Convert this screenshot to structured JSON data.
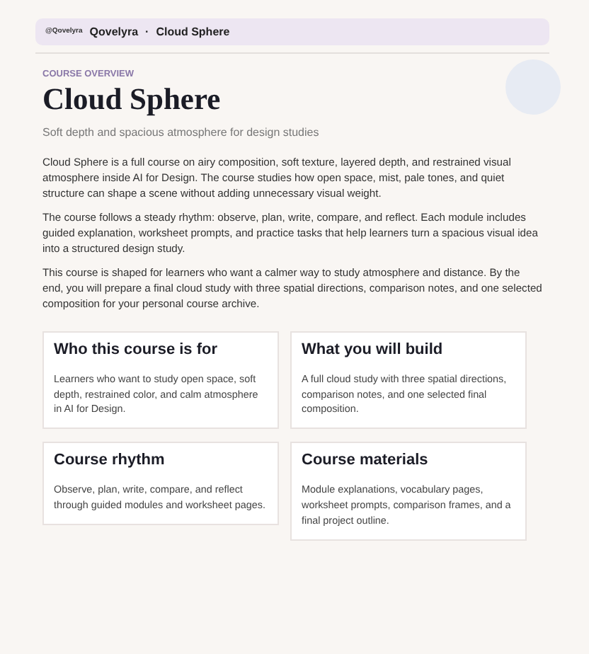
{
  "header": {
    "logo": "@Qovelyra",
    "brand": "Qovelyra",
    "separator": "·",
    "page": "Cloud Sphere"
  },
  "hero": {
    "eyebrow": "COURSE OVERVIEW",
    "title": "Cloud Sphere",
    "subtitle": "Soft depth and spacious atmosphere for design studies"
  },
  "paragraphs": [
    "Cloud Sphere is a full course on airy composition, soft texture, layered depth, and restrained visual atmosphere inside AI for Design. The course studies how open space, mist, pale tones, and quiet structure can shape a scene without adding unnecessary visual weight.",
    "The course follows a steady rhythm: observe, plan, write, compare, and reflect. Each module includes guided explanation, worksheet prompts, and practice tasks that help learners turn a spacious visual idea into a structured design study.",
    "This course is shaped for learners who want a calmer way to study atmosphere and distance. By the end, you will prepare a final cloud study with three spatial directions, comparison notes, and one selected composition for your personal course archive."
  ],
  "cards": [
    {
      "title": "Who this course is for",
      "text": "Learners who want to study open space, soft depth, restrained color, and calm atmosphere in AI for Design."
    },
    {
      "title": "What you will build",
      "text": "A full cloud study with three spatial directions, comparison notes, and one selected final composition."
    },
    {
      "title": "Course rhythm",
      "text": "Observe, plan, write, compare, and reflect through guided modules and worksheet pages."
    },
    {
      "title": "Course materials",
      "text": "Module explanations, vocabulary pages, worksheet prompts, comparison frames, and a final project outline."
    }
  ]
}
